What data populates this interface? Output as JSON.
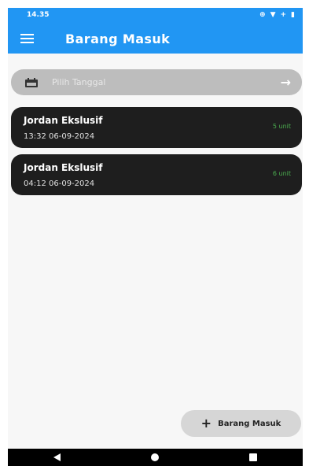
{
  "status_bar": {
    "time": "14.35",
    "icons": [
      "data-saver-icon",
      "wifi-icon",
      "plus-icon",
      "battery-icon"
    ]
  },
  "app_bar": {
    "title": "Barang Masuk",
    "background": "#2196f3"
  },
  "date_filter": {
    "label": "Pilih Tanggal"
  },
  "items": [
    {
      "name": "Jordan Ekslusif",
      "datetime": "13:32 06-09-2024",
      "quantity": "5 unit"
    },
    {
      "name": "Jordan Ekslusif",
      "datetime": "04:12 06-09-2024",
      "quantity": "6 unit"
    }
  ],
  "fab": {
    "label": "Barang Masuk"
  },
  "colors": {
    "card_bg": "#1e1e1e",
    "quantity_text": "#4caf50"
  }
}
